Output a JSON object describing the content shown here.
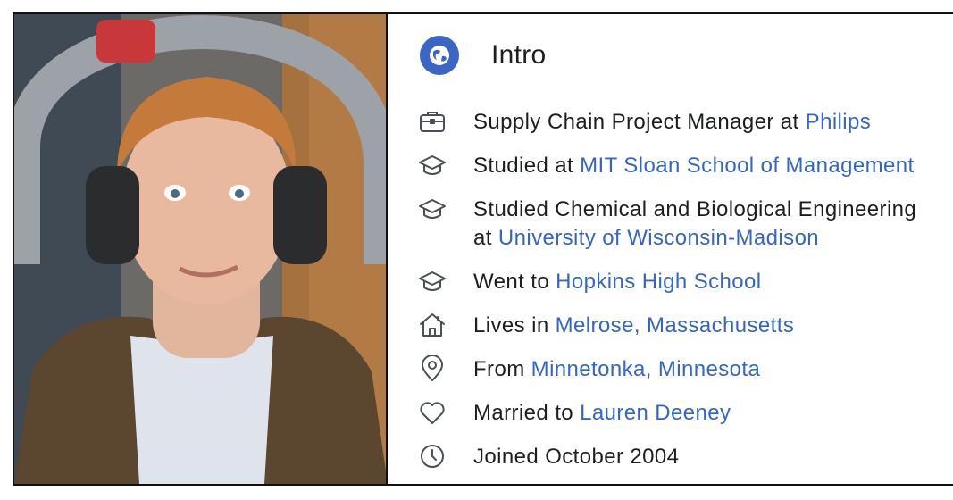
{
  "intro": {
    "title": "Intro",
    "rows": [
      {
        "icon": "briefcase-icon",
        "prefix": "Supply Chain Project Manager at ",
        "link": "Philips"
      },
      {
        "icon": "graduation-cap-icon",
        "prefix": "Studied at ",
        "link": "MIT Sloan School of Management"
      },
      {
        "icon": "graduation-cap-icon",
        "prefix": "Studied Chemical and Biological Engineering",
        "prefix2": "at ",
        "link": "University of Wisconsin-Madison"
      },
      {
        "icon": "graduation-cap-icon",
        "prefix": "Went to ",
        "link": "Hopkins High School"
      },
      {
        "icon": "home-icon",
        "prefix": "Lives in ",
        "link": "Melrose, Massachusetts"
      },
      {
        "icon": "location-pin-icon",
        "prefix": "From ",
        "link": "Minnetonka, Minnesota"
      },
      {
        "icon": "heart-icon",
        "prefix": "Married to ",
        "link": "Lauren Deeney"
      },
      {
        "icon": "clock-icon",
        "prefix": "Joined October 2004"
      }
    ]
  },
  "colors": {
    "link": "#3366cc",
    "badge": "#3b66c4",
    "text": "#1c1e21"
  }
}
